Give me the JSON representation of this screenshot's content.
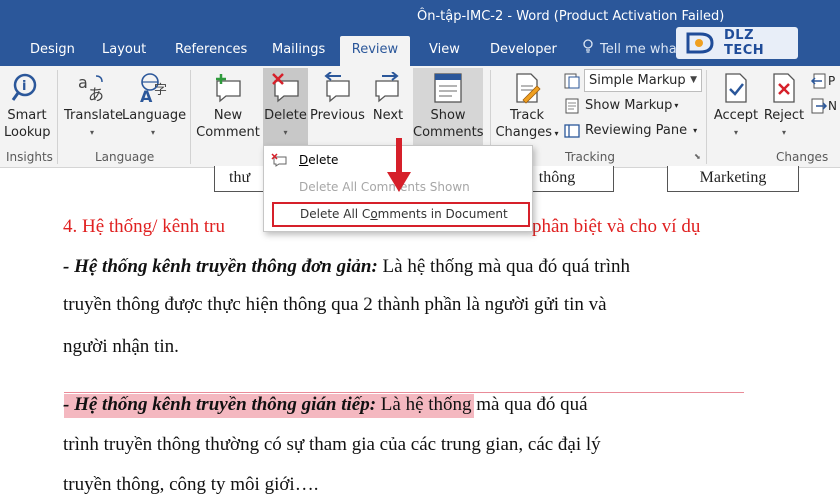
{
  "window": {
    "title": "Ôn-tập-IMC-2 - Word (Product Activation Failed)"
  },
  "logo": {
    "text": "DLZ TECH"
  },
  "tabs": [
    "Design",
    "Layout",
    "References",
    "Mailings",
    "Review",
    "View",
    "Developer"
  ],
  "active_tab": "Review",
  "tell_me": "Tell me what yo",
  "ribbon": {
    "smart_lookup": [
      "Smart",
      "Lookup"
    ],
    "translate": "Translate",
    "language": "Language",
    "new_comment": [
      "New",
      "Comment"
    ],
    "delete": "Delete",
    "previous": "Previous",
    "next": "Next",
    "show_comments": [
      "Show",
      "Comments"
    ],
    "track_changes": [
      "Track",
      "Changes"
    ],
    "markup_value": "Simple Markup",
    "show_markup": "Show Markup",
    "reviewing_pane": "Reviewing Pane",
    "accept": "Accept",
    "reject": "Reject",
    "groups": {
      "insights": "Insights",
      "language": "Language",
      "tracking": "Tracking",
      "changes": "Changes"
    }
  },
  "delete_menu": {
    "items": [
      {
        "label": "Delete",
        "underline": "D",
        "rest": "elete",
        "enabled": true
      },
      {
        "label": "Delete All Comments Shown",
        "enabled": false
      },
      {
        "label": "Delete All Comments in Document",
        "pre": "Delete All C",
        "underline": "o",
        "post": "mments in Document",
        "enabled": true,
        "highlighted": true
      }
    ]
  },
  "document": {
    "box_left": "thư",
    "box_mid": "thông",
    "box_right": "Marketing",
    "heading_left": "4. Hệ thống/ kênh tru",
    "heading_right": "phân biệt và cho ví dụ",
    "p1_bold": "- Hệ thống kênh truyền thông đơn giản:",
    "p1_rest": " Là hệ thống mà qua đó quá trình",
    "p1_line2": "truyền thông được thực hiện thông qua 2 thành phần là người gửi tin và",
    "p1_line3": "người nhận tin.",
    "p2_bold": " - Hệ thống kênh truyền thông gián tiếp",
    "p2_colon": ":",
    "p2_rest": " Là hệ thống mà qua đó quá",
    "p2_line2": "trình truyền thông thường có sự tham gia của các trung gian, các đại lý",
    "p2_line3": "truyền thông, công ty môi giới…."
  },
  "colors": {
    "word_blue": "#2b579a",
    "ribbon_bg": "#f3f3f3",
    "heading_red": "#e02020",
    "highlight_red": "#d6202a",
    "pink_highlight": "#f4b8c0"
  }
}
